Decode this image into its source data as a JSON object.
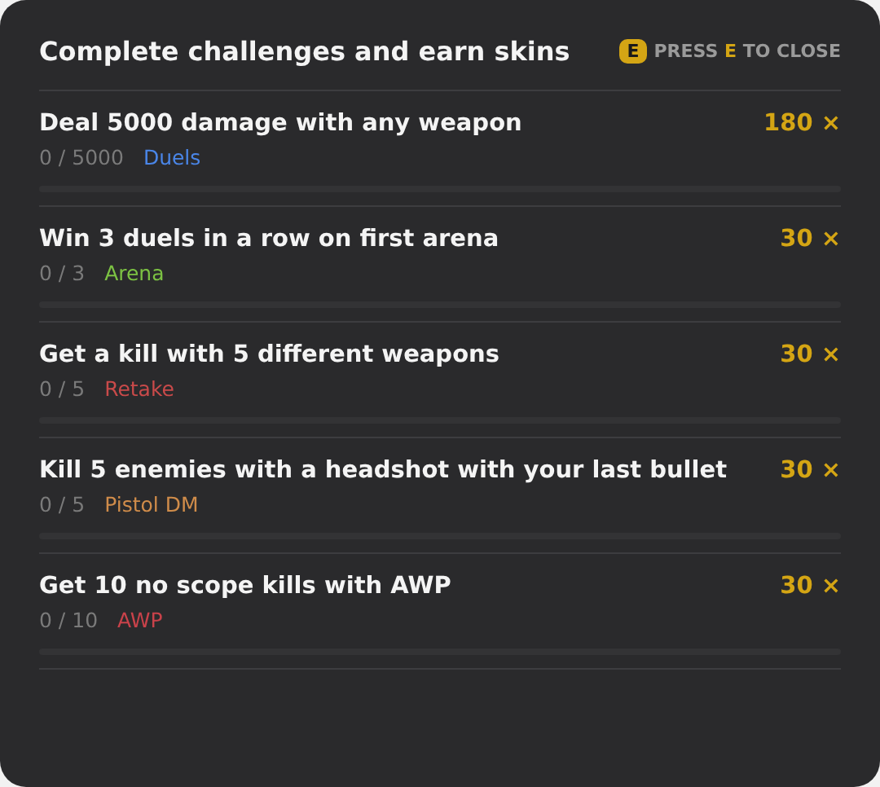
{
  "header": {
    "title": "Complete challenges and earn skins",
    "close_hint": {
      "key": "E",
      "before": "PRESS",
      "key_text": "E",
      "after": "TO CLOSE"
    }
  },
  "challenges": [
    {
      "title": "Deal 5000 damage with any weapon",
      "progress": "0 / 5000",
      "mode": "Duels",
      "color": "#4a86e8",
      "reward": "180 ×",
      "level": 0
    },
    {
      "title": "Win 3 duels in a row on first arena",
      "progress": "0 / 3",
      "mode": "Arena",
      "color": "#7cc243",
      "reward": "30 ×",
      "level": 0
    },
    {
      "title": "Get a kill with 5 different weapons",
      "progress": "0 / 5",
      "mode": "Retake",
      "color": "#c94a4a",
      "reward": "30 ×",
      "level": 0
    },
    {
      "title": "Kill 5 enemies with a headshot with your last bullet",
      "progress": "0 / 5",
      "mode": "Pistol DM",
      "color": "#d08c4a",
      "reward": "30 ×",
      "level": 0
    },
    {
      "title": "Get 10 no scope kills with AWP",
      "progress": "0 / 10",
      "mode": "AWP",
      "color": "#c9424a",
      "reward": "30 ×",
      "level": 0
    }
  ]
}
